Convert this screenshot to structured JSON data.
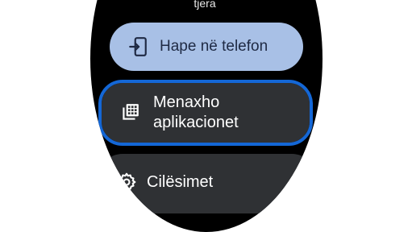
{
  "menu": {
    "top_partial_text": "tjera",
    "items": [
      {
        "label": "Hape në telefon",
        "icon": "open-on-phone-icon"
      },
      {
        "label_line1": "Menaxho",
        "label_line2": "aplikacionet",
        "icon": "apps-grid-icon",
        "focused": true
      },
      {
        "label": "Cilësimet",
        "icon": "gear-icon"
      }
    ]
  },
  "colors": {
    "background": "#ffffff",
    "watch_face": "#000000",
    "primary_chip": "#a8c0e6",
    "secondary_chip": "#2f3134",
    "focus_ring": "#1467d6"
  }
}
